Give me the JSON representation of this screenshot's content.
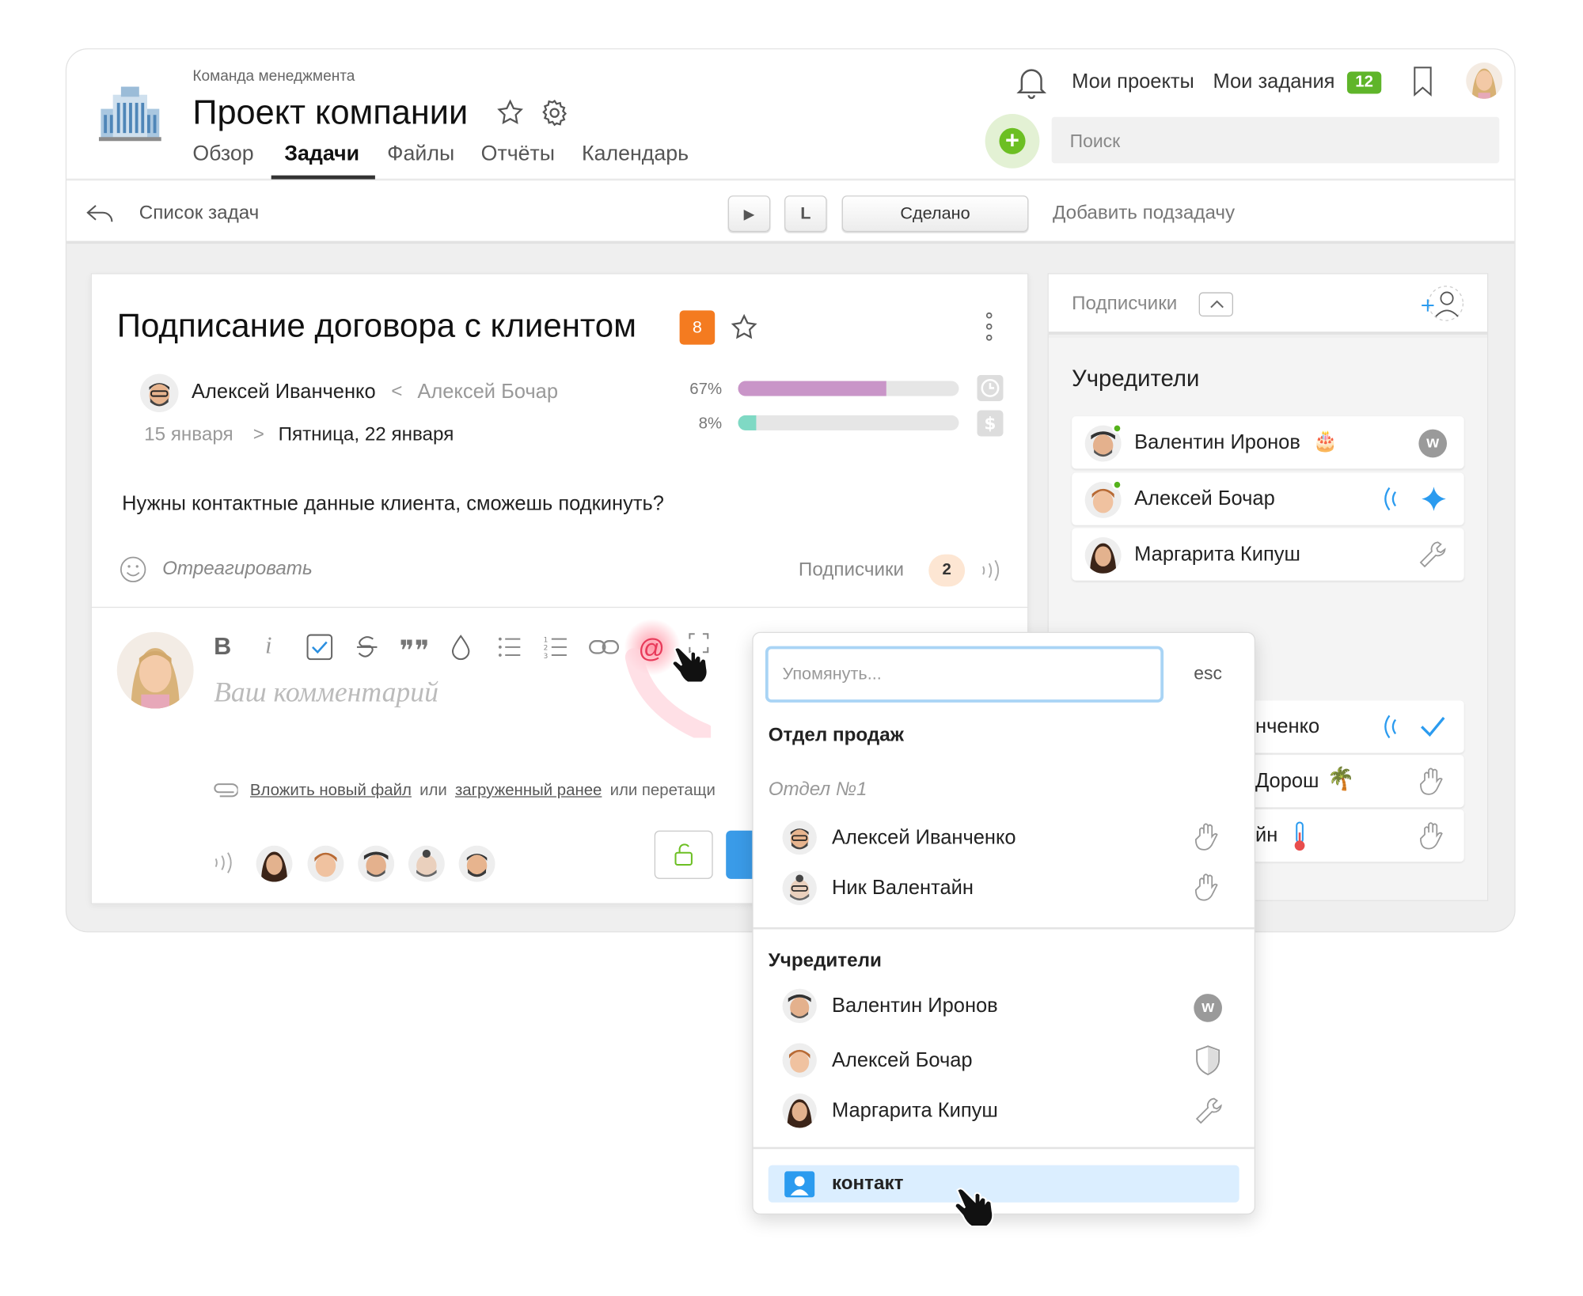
{
  "header": {
    "team": "Команда менеджмента",
    "project_title": "Проект компании",
    "tabs": [
      {
        "label": "Обзор"
      },
      {
        "label": "Задачи"
      },
      {
        "label": "Файлы"
      },
      {
        "label": "Отчёты"
      },
      {
        "label": "Календарь"
      }
    ],
    "my_projects": "Мои проекты",
    "my_tasks": "Мои задания",
    "my_tasks_count": "12",
    "search_placeholder": "Поиск"
  },
  "toolbar": {
    "back_label": "Список задач",
    "play_glyph": "▶",
    "l_label": "L",
    "done_label": "Сделано",
    "add_subtask": "Добавить подзадачу"
  },
  "task": {
    "title": "Подписание договора с клиентом",
    "priority": "8",
    "assignee": "Алексей Иванченко",
    "separator": "<",
    "author": "Алексей Бочар",
    "start_date": "15 января",
    "date_arrow": ">",
    "due_date": "Пятница, 22 января",
    "time_progress_label": "67%",
    "time_progress": 0.67,
    "budget_progress_label": "8%",
    "budget_progress": 0.08,
    "description": "Нужны контактные данные клиента, сможешь подкинуть?",
    "react_label": "Отреагировать",
    "subscribers_label": "Подписчики",
    "subscribers_count": "2"
  },
  "editor": {
    "placeholder": "Ваш комментарий",
    "attach_new": "Вложить новый файл",
    "or1": "или",
    "attach_prev": "загруженный ранее",
    "or_drag": "или перетащи"
  },
  "subscribers_panel": {
    "title": "Подписчики",
    "group": "Учредители",
    "members": [
      {
        "name": "Валентин Иронов"
      },
      {
        "name": "Алексей Бочар"
      },
      {
        "name": "Маргарита Кипуш"
      }
    ],
    "partial": [
      {
        "name": "нченко"
      },
      {
        "name": "Дорош"
      },
      {
        "name": "йн"
      }
    ]
  },
  "mention_dropdown": {
    "placeholder": "Упомянуть...",
    "esc": "esc",
    "section1": "Отдел продаж",
    "subsection1": "Отдел №1",
    "section1_people": [
      {
        "name": "Алексей Иванченко"
      },
      {
        "name": "Ник Валентайн"
      }
    ],
    "section2": "Учредители",
    "section2_people": [
      {
        "name": "Валентин Иронов"
      },
      {
        "name": "Алексей Бочар"
      },
      {
        "name": "Маргарита Кипуш"
      }
    ],
    "contact_label": "контакт"
  },
  "colors": {
    "accent_green": "#6fbf2c",
    "priority_orange": "#f47b20",
    "progress_time": "#c995c8",
    "progress_budget": "#7fd9c4",
    "link_blue": "#2b9bef",
    "contact_bg": "#dbeeff"
  }
}
